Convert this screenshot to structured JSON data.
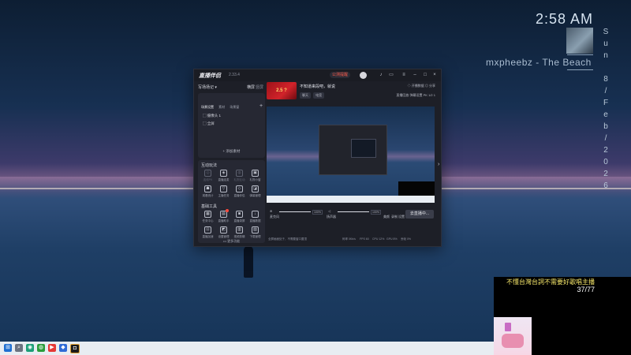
{
  "desktop": {
    "time": "2:58 AM",
    "date_vertical": [
      "S",
      "u",
      "n",
      "",
      "8",
      "/",
      "F",
      "e",
      "b",
      "/",
      "2",
      "0",
      "2",
      "6"
    ],
    "now_playing": "mxpheebz - The Beach"
  },
  "app": {
    "logo": "直播伴侣",
    "version": "2.33.4",
    "notice_pill": "公测提醒",
    "sidebar": {
      "scene_header": "写场场记 ▾",
      "mode_label": "横屏",
      "mode_alt": "竖屏",
      "tabs": [
        "场景设置",
        "素材",
        "场景窗"
      ],
      "sources": [
        {
          "icon": "▢",
          "label": "摄像头 1"
        },
        {
          "icon": "▢",
          "label": "全屏"
        }
      ],
      "add_source": "+ 添加素材",
      "interaction_title": "互动玩法",
      "interaction_tools": [
        {
          "label": "连线PK",
          "dim": true
        },
        {
          "label": "直播连麦",
          "dim": false
        },
        {
          "label": "礼物互动",
          "dim": true
        },
        {
          "label": "礼物小窗",
          "dim": false
        },
        {
          "label": "观看统计",
          "dim": false
        },
        {
          "label": "主播任务",
          "dim": false
        },
        {
          "label": "直播伴侣",
          "dim": false
        },
        {
          "label": "弹幕管理",
          "dim": false
        }
      ],
      "basic_title": "基础工具",
      "basic_tools": [
        {
          "label": "任务中心",
          "badge": false
        },
        {
          "label": "直播助手",
          "badge": true
        },
        {
          "label": "直播录屏",
          "badge": false
        },
        {
          "label": "直播数据",
          "badge": false
        },
        {
          "label": "直播加速",
          "badge": false
        },
        {
          "label": "设置管理",
          "badge": false
        },
        {
          "label": "视频剪辑",
          "badge": false
        },
        {
          "label": "下载管理",
          "badge": false
        }
      ],
      "more": "••• 更多功能"
    },
    "main": {
      "thumb_text": "2.5 ?",
      "stream_title": "不知道来段吧，就说",
      "tags": [
        "聊天",
        "电竞"
      ],
      "top_right": "◇ 开播数据   ◎ 分享",
      "stats_line": "直播回放  弹幕设置  PK  1/2  1",
      "preview_label": "",
      "mic_label": "麦克风",
      "mic_level": 100,
      "mic_pct": "100%",
      "speaker_label": "扬声器",
      "speaker_level": 100,
      "speaker_pct": "100%",
      "right_controls": [
        "美颜",
        "录制",
        "设置"
      ],
      "go_live": "去直播中...",
      "status_left": "全屏画面处于，不需要窗口置顶",
      "status_items": [
        "码率 0Kb/s",
        "FPS 60",
        "CPU 12%",
        "GPU 8%",
        "丢帧 0%"
      ]
    }
  },
  "overlay": {
    "caption": "不懂台灣台詞不需要好歌唱主播",
    "count": "37/77"
  },
  "taskbar": {
    "items": [
      "windows",
      "search",
      "browser",
      "chat",
      "media",
      "app",
      "game",
      "live"
    ]
  }
}
